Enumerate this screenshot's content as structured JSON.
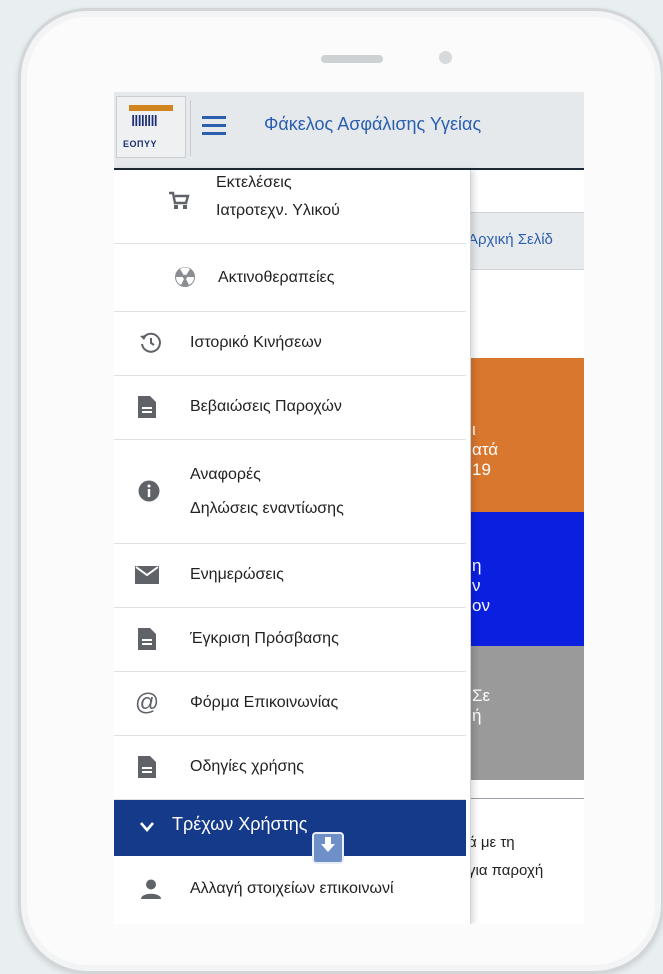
{
  "app": {
    "title": "Φάκελος Ασφάλισης Υγείας",
    "logo_text": "ΕΟΠΥΥ"
  },
  "underlying": {
    "breadcrumb": "Αρχική Σελίδ",
    "tiles": [
      {
        "lines": [
          "ι",
          "ατά",
          "19"
        ],
        "color": "#d9772f"
      },
      {
        "lines": [
          "η",
          "ν",
          "ον"
        ],
        "color": "#0a1fe0"
      },
      {
        "lines": [
          "Σε",
          "ή"
        ],
        "color": "#9a9a9a"
      }
    ],
    "text_lines": [
      "ά με τη",
      "για παροχή"
    ]
  },
  "drawer": {
    "items": [
      {
        "icon": "cart-icon",
        "line1": "Εκτελέσεις",
        "line2": "Ιατροτεχν. Υλικού"
      },
      {
        "icon": "radiation-icon",
        "line1": "Ακτινοθεραπείες"
      },
      {
        "icon": "history-icon",
        "line1": "Ιστορικό Κινήσεων"
      },
      {
        "icon": "document-icon",
        "line1": "Βεβαιώσεις Παροχών"
      },
      {
        "icon": "info-icon",
        "line1": "Αναφορές",
        "line2": "Δηλώσεις εναντίωσης"
      },
      {
        "icon": "mail-icon",
        "line1": "Ενημερώσεις"
      },
      {
        "icon": "document-icon",
        "line1": "Έγκριση Πρόσβασης"
      },
      {
        "icon": "at-icon",
        "line1": "Φόρμα Επικοινωνίας"
      },
      {
        "icon": "document-icon",
        "line1": "Οδηγίες χρήσης"
      }
    ],
    "current_user": "Τρέχων Χρήστης",
    "sub_item": {
      "icon": "person-icon",
      "label": "Αλλαγή στοιχείων επικοινωνί"
    }
  },
  "colors": {
    "accent": "#2a5fb0",
    "current_user_bg": "#153a8a",
    "logo_orange": "#d2841f"
  }
}
